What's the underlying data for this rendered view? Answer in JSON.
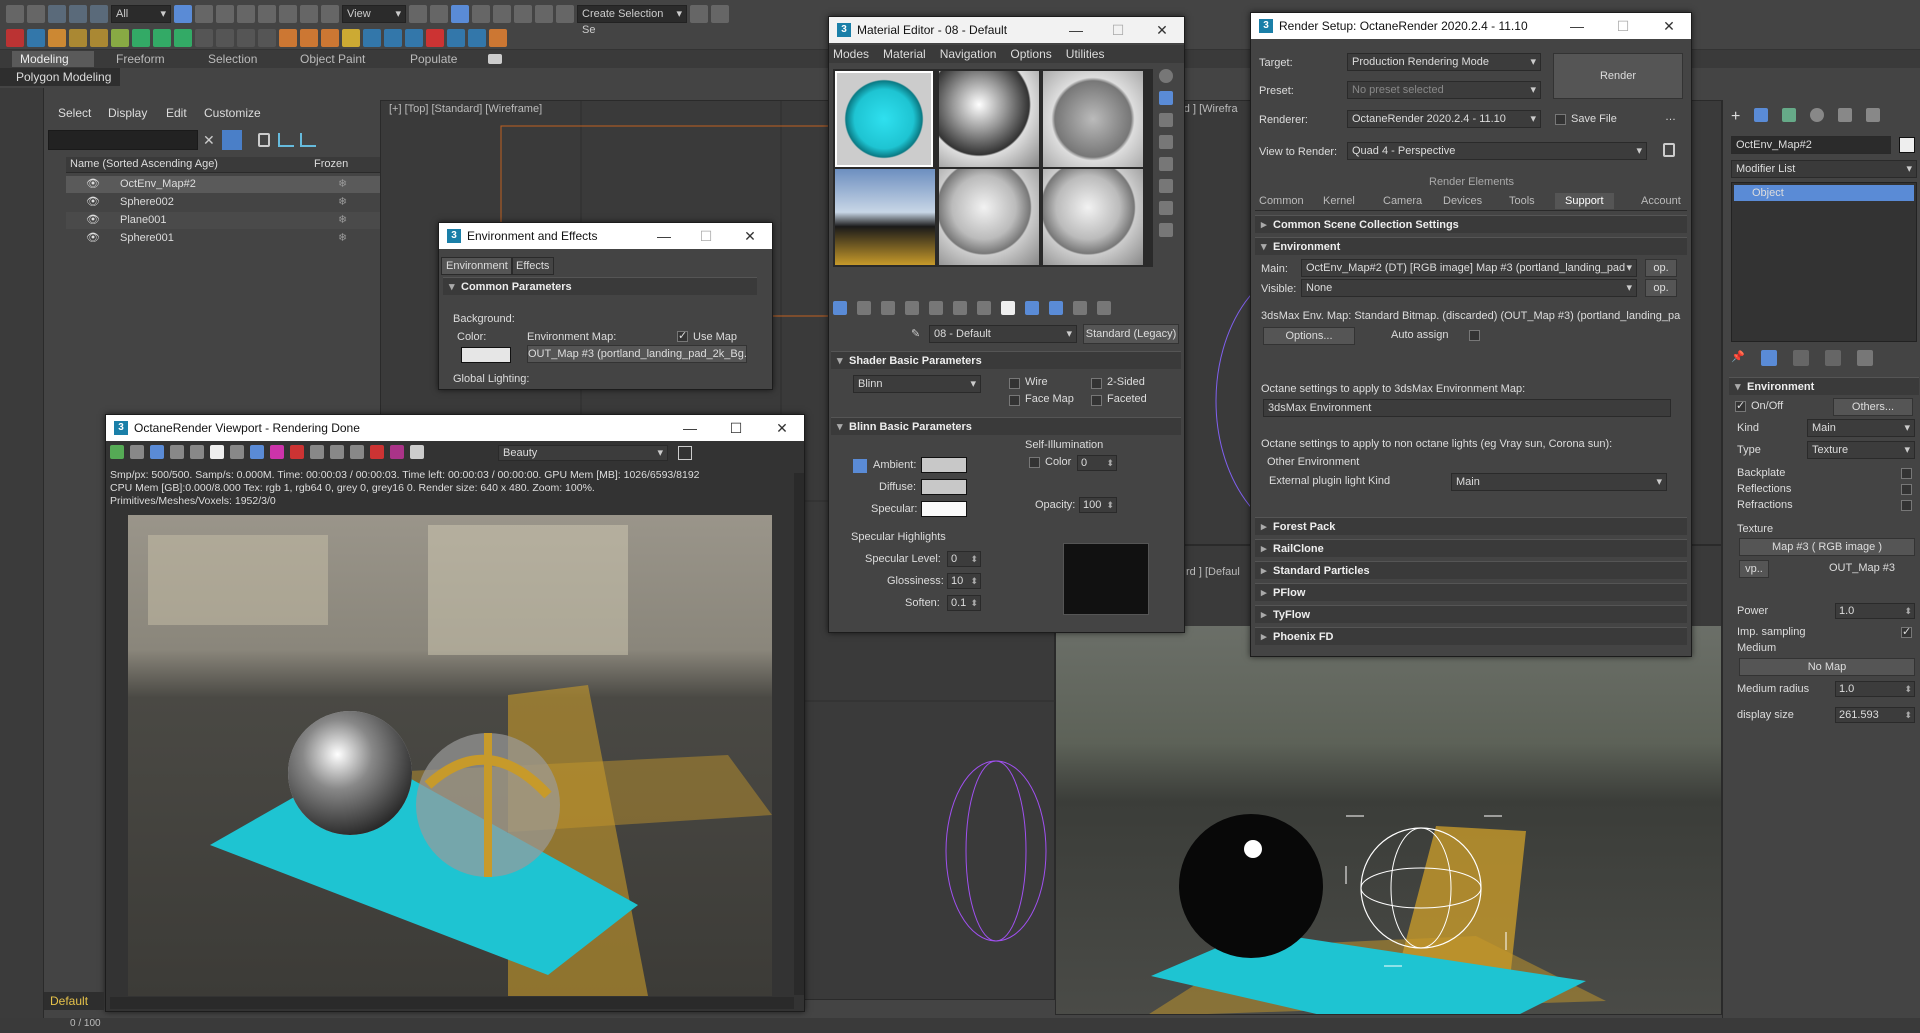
{
  "toolbar": {
    "selection_filter": "All",
    "view_ref": "View",
    "create_sel_set": "Create Selection Se"
  },
  "ribbon": {
    "tabs": [
      "Modeling",
      "Freeform",
      "Selection",
      "Object Paint",
      "Populate"
    ],
    "active": "Modeling",
    "sub": "Polygon Modeling"
  },
  "scene_explorer": {
    "menu": [
      "Select",
      "Display",
      "Edit",
      "Customize"
    ],
    "col_name": "Name (Sorted Ascending Age)",
    "col_frozen": "Frozen",
    "rows": [
      "OctEnv_Map#2",
      "Sphere002",
      "Plane001",
      "Sphere001"
    ]
  },
  "viewports": {
    "top_label": "[+] [Top] [Standard] [Wireframe]",
    "right_label": "ard ] [Wirefra",
    "bottom_label": "rd ] [Defaul"
  },
  "env_effects": {
    "title": "Environment and Effects",
    "tabs": [
      "Environment",
      "Effects"
    ],
    "rollout": "Common Parameters",
    "background": "Background:",
    "color": "Color:",
    "env_map": "Environment Map:",
    "use_map": "Use Map",
    "map_name": "OUT_Map #3 (portland_landing_pad_2k_Bg.j",
    "global": "Global Lighting:"
  },
  "octane_vp": {
    "title": "OctaneRender Viewport - Rendering Done",
    "pass": "Beauty",
    "stats1": "Smp/px: 500/500.   Samp/s: 0.000M.   Time: 00:00:03 / 00:00:03.   Time left: 00:00:03 / 00:00:00.   GPU Mem [MB]: 1026/6593/8192",
    "stats2": "CPU Mem [GB]:0.000/8.000   Tex: rgb 1, rgb64 0, grey 0, grey16 0.   Render size: 640 x 480.   Zoom: 100%.",
    "stats3": "Primitives/Meshes/Voxels: 1952/3/0"
  },
  "material_editor": {
    "title": "Material Editor - 08 - Default",
    "menu": [
      "Modes",
      "Material",
      "Navigation",
      "Options",
      "Utilities"
    ],
    "mat_name": "08 - Default",
    "mat_type": "Standard (Legacy)",
    "shader_rollout": "Shader Basic Parameters",
    "shader": "Blinn",
    "wire": "Wire",
    "twosided": "2-Sided",
    "facemap": "Face Map",
    "faceted": "Faceted",
    "blinn_rollout": "Blinn Basic Parameters",
    "self_illum": "Self-Illumination",
    "color": "Color",
    "color_val": "0",
    "ambient": "Ambient:",
    "diffuse": "Diffuse:",
    "specular": "Specular:",
    "opacity": "Opacity:",
    "opacity_val": "100",
    "spec_hl": "Specular Highlights",
    "spec_level": "Specular Level:",
    "spec_level_val": "0",
    "glossiness": "Glossiness:",
    "glossiness_val": "10",
    "soften": "Soften:",
    "soften_val": "0.1"
  },
  "render_setup": {
    "title": "Render Setup: OctaneRender 2020.2.4 - 11.10",
    "target_lbl": "Target:",
    "target": "Production Rendering Mode",
    "preset_lbl": "Preset:",
    "preset": "No preset selected",
    "renderer_lbl": "Renderer:",
    "renderer": "OctaneRender 2020.2.4 - 11.10",
    "save_file": "Save File",
    "view_lbl": "View to Render:",
    "view": "Quad 4 - Perspective",
    "render_btn": "Render",
    "render_elements": "Render Elements",
    "tabs": [
      "Common",
      "Kernel",
      "Camera",
      "Devices",
      "Tools",
      "Support",
      "Account"
    ],
    "active_tab": "Support",
    "rollouts_top": [
      "Common Scene Collection Settings",
      "Environment"
    ],
    "main_lbl": "Main:",
    "main": "OctEnv_Map#2 (DT) [RGB image] Map #3 (portland_landing_pad",
    "visible_lbl": "Visible:",
    "visible": "None",
    "op": "op.",
    "env_map_line": "3dsMax Env. Map:  Standard Bitmap. (discarded) (OUT_Map #3) (portland_landing_pa",
    "options": "Options...",
    "auto_assign": "Auto assign",
    "octane_apply": "Octane settings to apply to 3dsMax Environment Map:",
    "max_env": "3dsMax Environment",
    "octane_apply2": "Octane settings to apply to non octane lights (eg Vray sun, Corona sun):",
    "other_env": "Other Environment",
    "ext_plugin": "External plugin light Kind",
    "ext_val": "Main",
    "rollouts_bottom": [
      "Forest Pack",
      "RailClone",
      "Standard Particles",
      "PFlow",
      "TyFlow",
      "Phoenix FD"
    ]
  },
  "command_panel": {
    "obj_name": "OctEnv_Map#2",
    "modifier_list": "Modifier List",
    "object": "Object",
    "rollout": "Environment",
    "onoff": "On/Off",
    "others": "Others...",
    "kind_lbl": "Kind",
    "kind": "Main",
    "type_lbl": "Type",
    "type": "Texture",
    "backplate": "Backplate",
    "reflections": "Reflections",
    "refractions": "Refractions",
    "texture_lbl": "Texture",
    "texture": "Map #3  ( RGB image )",
    "vp": "vp..",
    "out_map": "OUT_Map #3",
    "power_lbl": "Power",
    "power": "1.0",
    "imp_lbl": "Imp. sampling",
    "medium_lbl": "Medium",
    "nomap": "No Map",
    "medrad_lbl": "Medium radius",
    "medrad": "1.0",
    "disp_lbl": "display size",
    "disp": "261.593"
  },
  "status": {
    "layer": "Default",
    "progress": "0 / 100"
  },
  "colors": {
    "cyan": "#19c9d8",
    "ui_bg": "#444444",
    "highlight": "#5a8bd6"
  }
}
